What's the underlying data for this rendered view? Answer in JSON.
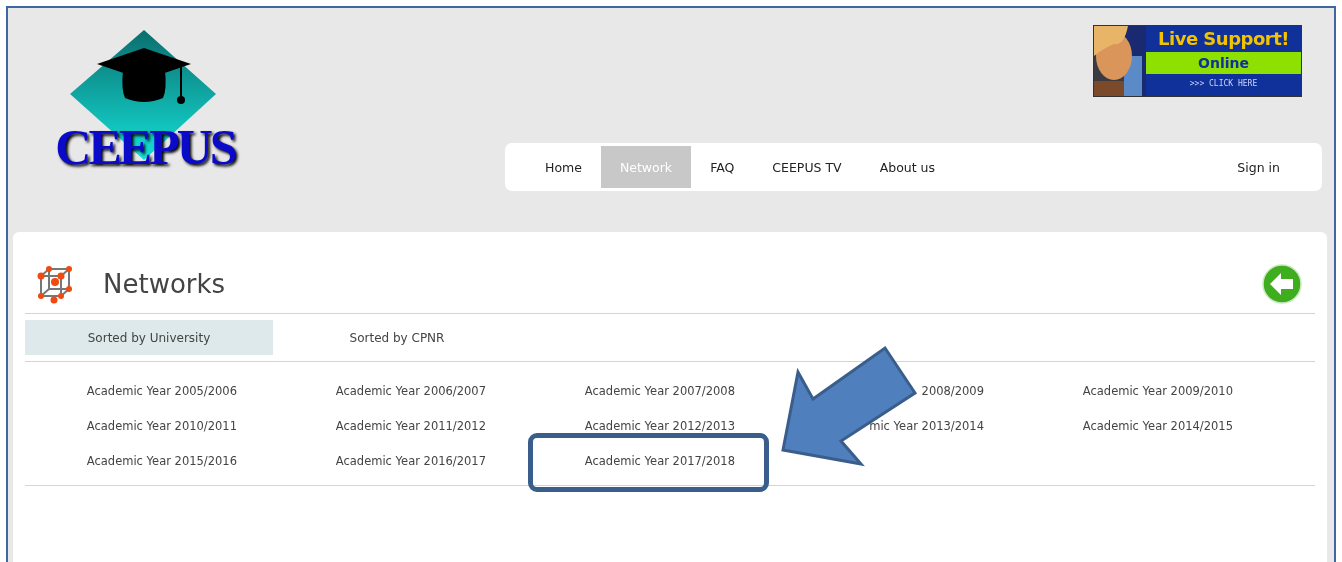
{
  "logo": {
    "text": "CEEPUS"
  },
  "live_support": {
    "title": "Live Support!",
    "status": "Online",
    "action": ">>> CLICK HERE"
  },
  "nav": {
    "items": [
      {
        "label": "Home",
        "selected": false
      },
      {
        "label": "Network",
        "selected": true
      },
      {
        "label": "FAQ",
        "selected": false
      },
      {
        "label": "CEEPUS TV",
        "selected": false
      },
      {
        "label": "About us",
        "selected": false
      }
    ],
    "sign_in": "Sign in"
  },
  "page": {
    "title": "Networks"
  },
  "tabs": [
    {
      "label": "Sorted by University",
      "selected": true
    },
    {
      "label": "Sorted by CPNR",
      "selected": false
    }
  ],
  "years": [
    "Academic Year 2005/2006",
    "Academic Year 2006/2007",
    "Academic Year 2007/2008",
    "2008/2009",
    "Academic Year 2009/2010",
    "Academic Year 2010/2011",
    "Academic Year 2011/2012",
    "Academic Year 2012/2013",
    "mic Year 2013/2014",
    "Academic Year 2014/2015",
    "Academic Year 2015/2016",
    "Academic Year 2016/2017",
    "Academic Year 2017/2018"
  ]
}
